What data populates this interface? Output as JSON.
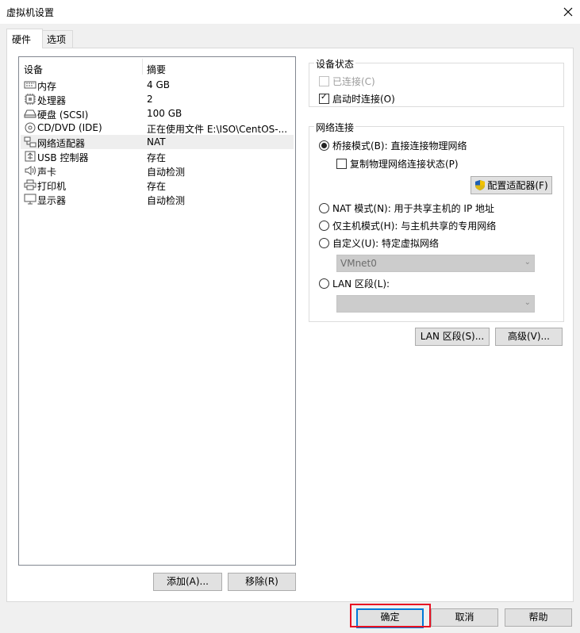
{
  "window": {
    "title": "虚拟机设置"
  },
  "tabs": [
    {
      "label": "硬件"
    },
    {
      "label": "选项"
    }
  ],
  "device_list": {
    "headers": {
      "device": "设备",
      "summary": "摘要"
    },
    "rows": [
      {
        "name": "内存",
        "summary": "4 GB",
        "icon": "memory-icon"
      },
      {
        "name": "处理器",
        "summary": "2",
        "icon": "processor-icon"
      },
      {
        "name": "硬盘 (SCSI)",
        "summary": "100 GB",
        "icon": "hard-disk-icon"
      },
      {
        "name": "CD/DVD (IDE)",
        "summary": "正在使用文件 E:\\ISO\\CentOS-...",
        "icon": "cd-dvd-icon"
      },
      {
        "name": "网络适配器",
        "summary": "NAT",
        "icon": "network-adapter-icon"
      },
      {
        "name": "USB 控制器",
        "summary": "存在",
        "icon": "usb-icon"
      },
      {
        "name": "声卡",
        "summary": "自动检测",
        "icon": "sound-icon"
      },
      {
        "name": "打印机",
        "summary": "存在",
        "icon": "printer-icon"
      },
      {
        "name": "显示器",
        "summary": "自动检测",
        "icon": "display-icon"
      }
    ]
  },
  "list_buttons": {
    "add": "添加(A)...",
    "remove": "移除(R)"
  },
  "device_status": {
    "title": "设备状态",
    "connected": "已连接(C)",
    "connect_at_power_on": "启动时连接(O)"
  },
  "network": {
    "title": "网络连接",
    "bridged": "桥接模式(B): 直接连接物理网络",
    "replicate": "复制物理网络连接状态(P)",
    "configure_adapters": "配置适配器(F)",
    "nat": "NAT 模式(N): 用于共享主机的 IP 地址",
    "host_only": "仅主机模式(H): 与主机共享的专用网络",
    "custom": "自定义(U): 特定虚拟网络",
    "custom_value": "VMnet0",
    "lan_segment": "LAN 区段(L):",
    "lan_segment_value": ""
  },
  "network_buttons": {
    "lan_segments": "LAN 区段(S)...",
    "advanced": "高级(V)..."
  },
  "footer": {
    "ok": "确定",
    "cancel": "取消",
    "help": "帮助"
  },
  "colors": {
    "focus_border": "#0078d7",
    "highlight_box": "#e81123",
    "shield_blue": "#1e5fb4",
    "shield_yellow": "#f2c200"
  }
}
